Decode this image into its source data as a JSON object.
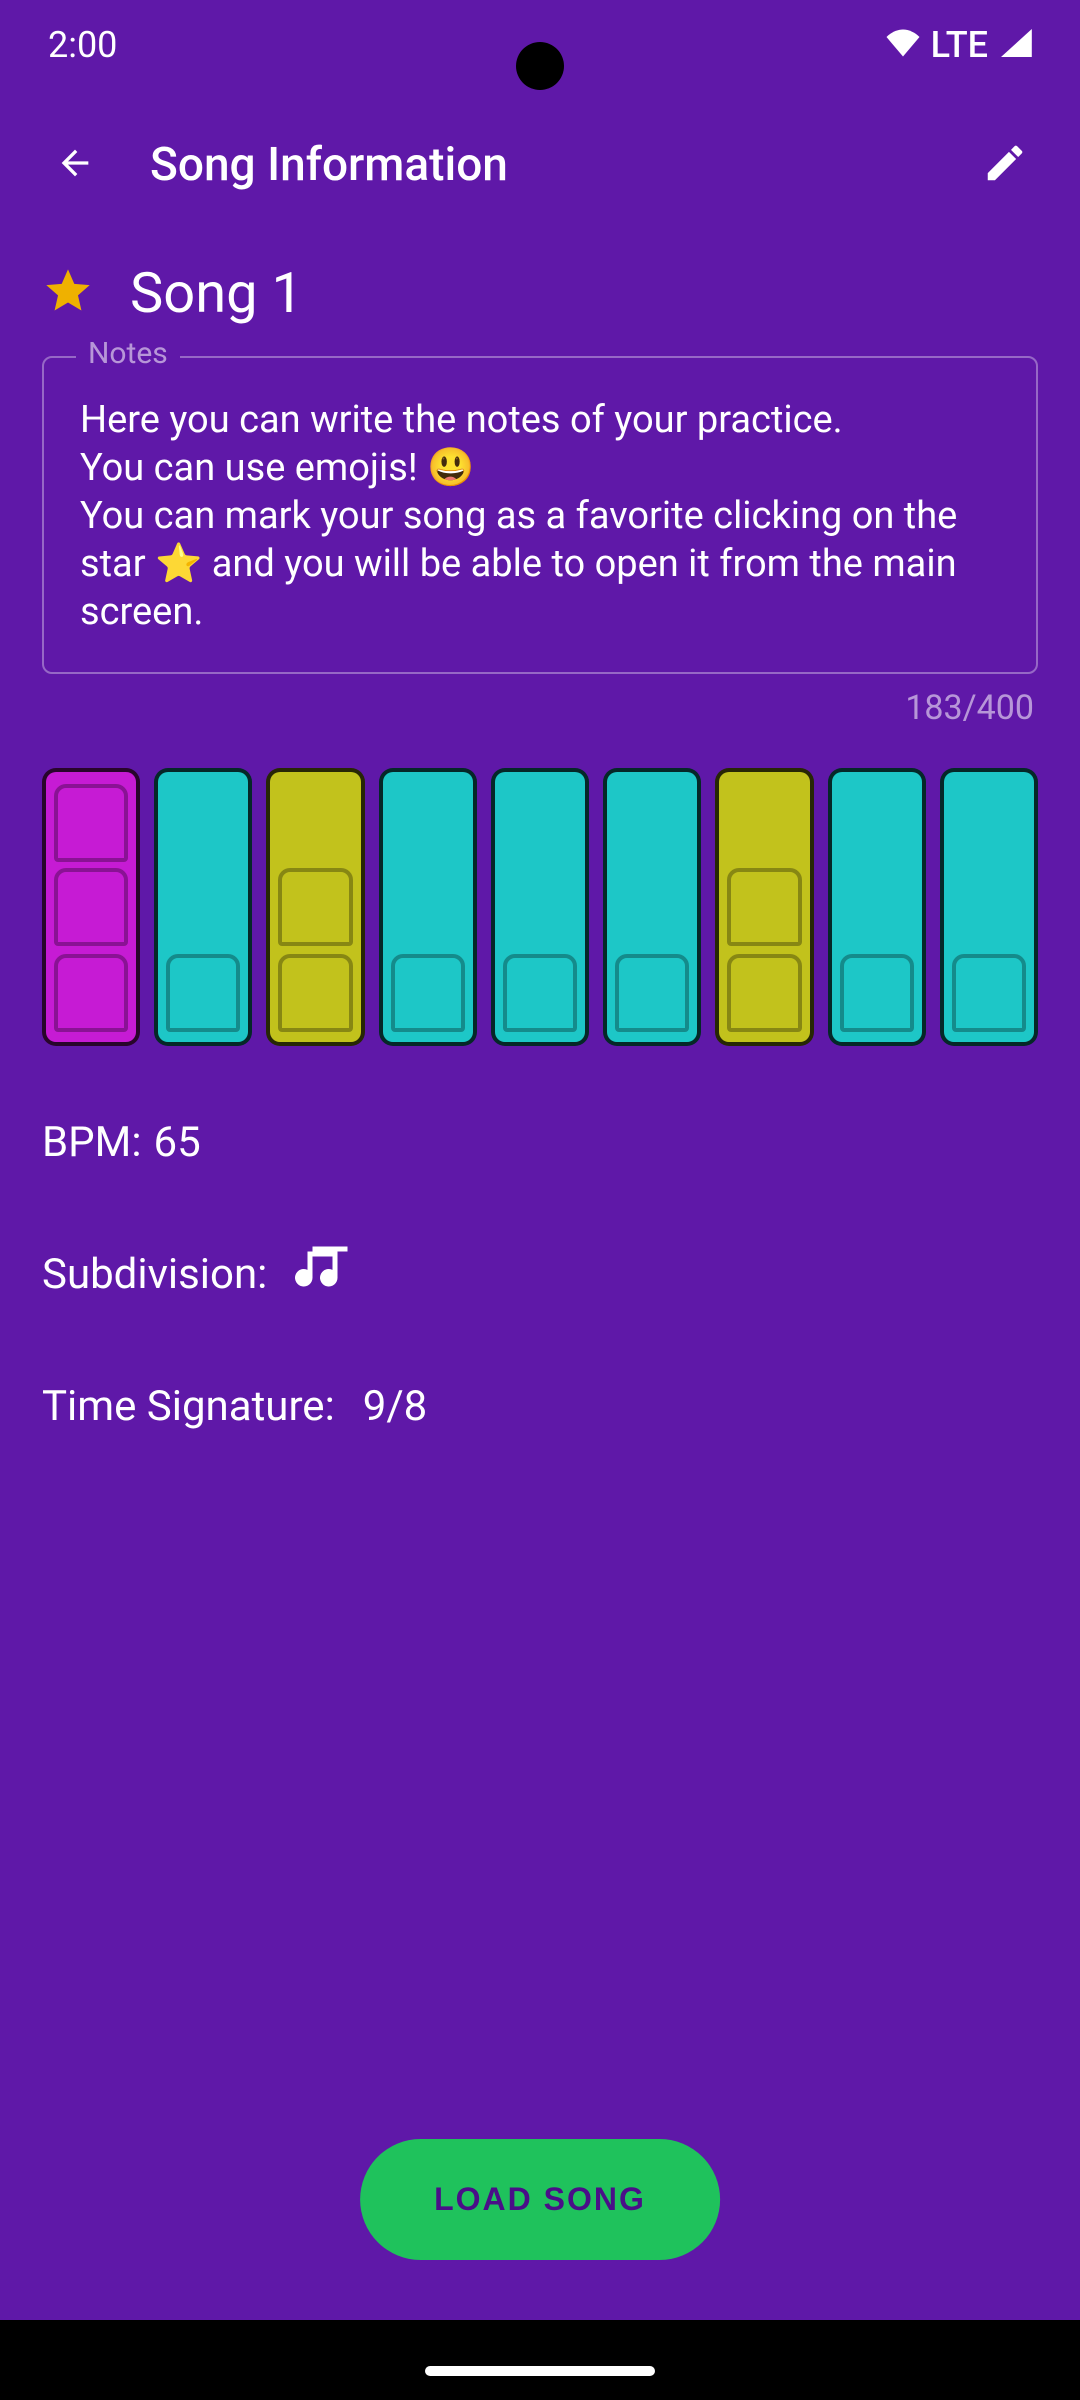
{
  "status": {
    "time": "2:00",
    "network": "LTE"
  },
  "header": {
    "title": "Song Information"
  },
  "song": {
    "name": "Song 1",
    "favorite": true
  },
  "notes": {
    "label": "Notes",
    "text": "Here you can write the notes of your practice.\nYou can use emojis! 😃\nYou can mark your song as a favorite clicking on the star ⭐ and you will be able to open it from the main screen.",
    "counter": "183/400"
  },
  "beats": [
    {
      "color": "magenta",
      "segments": 3
    },
    {
      "color": "teal",
      "segments": 1
    },
    {
      "color": "olive",
      "segments": 2
    },
    {
      "color": "teal",
      "segments": 1
    },
    {
      "color": "teal",
      "segments": 1
    },
    {
      "color": "teal",
      "segments": 1
    },
    {
      "color": "olive",
      "segments": 2
    },
    {
      "color": "teal",
      "segments": 1
    },
    {
      "color": "teal",
      "segments": 1
    }
  ],
  "details": {
    "bpm_label": "BPM:",
    "bpm_value": "65",
    "subdivision_label": "Subdivision:",
    "time_sig_label": "Time Signature:",
    "time_sig_value": "9/8"
  },
  "actions": {
    "load_label": "LOAD SONG"
  }
}
